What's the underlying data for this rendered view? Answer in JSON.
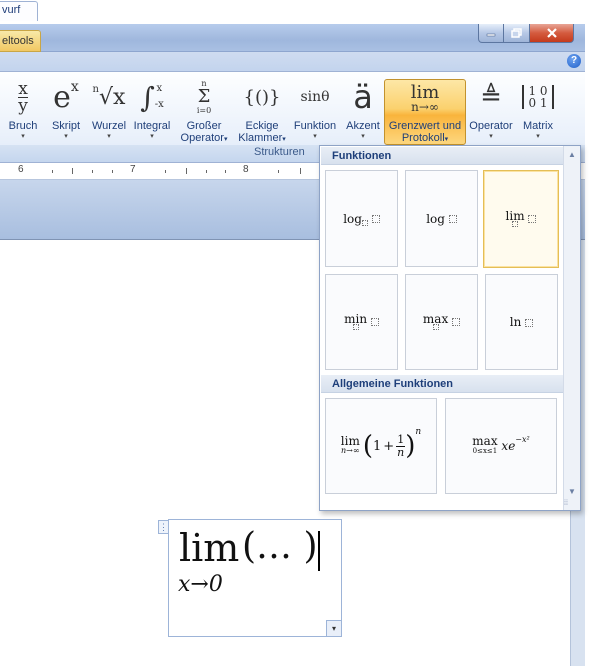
{
  "window": {
    "contextual_tab": "eltools",
    "active_tab": "vurf",
    "help": "?"
  },
  "ribbon": {
    "buttons": [
      {
        "id": "bruch",
        "label": "Bruch",
        "glyph_top": "x",
        "glyph_bottom": "y"
      },
      {
        "id": "skript",
        "label": "Skript",
        "glyph": "e",
        "sup": "x"
      },
      {
        "id": "wurzel",
        "label": "Wurzel",
        "glyph": "√x",
        "index": "n"
      },
      {
        "id": "integral",
        "label": "Integral",
        "glyph": "∫",
        "upper": "x",
        "lower": "-x"
      },
      {
        "id": "grosser-operator",
        "label": "Großer",
        "label2": "Operator",
        "glyph": "Σ",
        "upper": "n",
        "lower": "i=0"
      },
      {
        "id": "eckige-klammer",
        "label": "Eckige",
        "label2": "Klammer",
        "glyph": "{()}"
      },
      {
        "id": "funktion",
        "label": "Funktion",
        "glyph": "sinθ"
      },
      {
        "id": "akzent",
        "label": "Akzent",
        "glyph": "ä"
      },
      {
        "id": "grenzwert",
        "label": "Grenzwert und",
        "label2": "Protokoll",
        "glyph": "lim",
        "sub": "n→∞"
      },
      {
        "id": "operator",
        "label": "Operator",
        "glyph": "≜"
      },
      {
        "id": "matrix",
        "label": "Matrix",
        "row1": "1 0",
        "row2": "0 1"
      }
    ],
    "group_label": "Strukturen",
    "arrow": "▾"
  },
  "ruler": {
    "numbers": [
      "6",
      "7",
      "8"
    ]
  },
  "gallery": {
    "section1": "Funktionen",
    "section2": "Allgemeine Funktionen",
    "functions": [
      {
        "id": "log-base",
        "text": "log"
      },
      {
        "id": "log",
        "text": "log"
      },
      {
        "id": "lim",
        "text": "lim"
      },
      {
        "id": "min",
        "text": "min"
      },
      {
        "id": "max",
        "text": "max"
      },
      {
        "id": "ln",
        "text": "ln"
      }
    ],
    "general": [
      {
        "id": "lim-example",
        "op": "lim",
        "sub": "n→∞",
        "one": "1",
        "plus": "+",
        "num": "1",
        "den": "n",
        "exp": "n"
      },
      {
        "id": "max-example",
        "op": "max",
        "sub": "0≤x≤1",
        "body": "xe",
        "exp": "−x²"
      }
    ]
  },
  "equation": {
    "lim": "lim",
    "sub": "x→0",
    "args": "(… )"
  }
}
